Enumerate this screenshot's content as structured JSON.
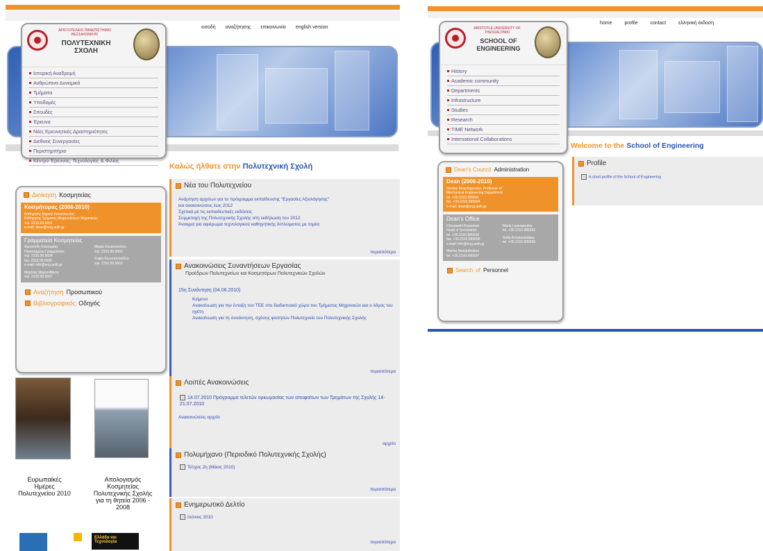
{
  "left": {
    "topnav": [
      "εισοδή",
      "αναζήτησης",
      "επικοινωνία",
      "english version"
    ],
    "university": "ΑΡΙΣΤΟΤΕΛΕΙΟ ΠΑΝΕΠΙΣΤΗΜΙΟ ΘΕΣΣΑΛΟΝΙΚΗΣ",
    "school": "ΠΟΛΥΤΕΧΝΙΚΗ ΣΧΟΛΗ",
    "menu": [
      "Ιστορική Αναδρομή",
      "Ανθρώπινο Δυναμικό",
      "Τμήματα",
      "Υποδομές",
      "Σπουδές",
      "Έρευνα",
      "Νέες Ερευνητικές Δραστηριότητες",
      "Διεθνείς Συνεργασίες",
      "Περιστηριτήριο",
      "Κέντρο Έρευνας, Τεχνολογίας & Φιλίας"
    ],
    "admin_title_a": "Διοίκηση",
    "admin_title_b": "Κοσμητείας",
    "dean_head": "Κοσμήτορας (2006-2010)",
    "dean_lines": [
      "Καθηγητής Μιχαήλ Κοντοπουλος",
      "Καθηγητής Τμήματος Μηχανολόγων Μηχανικών",
      "τηλ. 2310.99.5691",
      "e-mail: dean@eng.auth.gr"
    ],
    "office_head": "Γραμματεία Κοσμητείας",
    "office_col1": [
      "Χρυσάνθη Κασσιμάτη",
      "Προϊσταμένη Γραμματείας",
      "τηλ. 2310.99.5694",
      "fax: 2310.99.5695",
      "e-mail: info@eng.auth.gr",
      "",
      "Μαρίνας Μαριανθάκου",
      "τηλ. 2310.99.5697"
    ],
    "office_col2": [
      "Μαρία Λουκοπούλου",
      "τηλ. 2310.99.5692",
      "",
      "Σοφία Κωνσταντινίδου",
      "τηλ. 2310.99.5693"
    ],
    "search_a": "Αναζήτηση",
    "search_b": "Προσωπικού",
    "biblio_a": "Βιβλιογραφικός",
    "biblio_b": "Οδηγός",
    "welcome_a": "Καλώς ήλθατε στην",
    "welcome_b": "Πολυτεχνική Σχολή",
    "news_title": "Νέα του Πολυτεχνείου",
    "news_items": [
      "Ανάρτηση αρχείων για το πρόγραμμα εκπαίδευσης \"Εργασίες Αξιολόγησης\"",
      "και ανακοινώσεις έως 2012",
      "Σχετικά με τις εκπαιδευτικές εκδόσεις",
      "Συμμετοχή της Πολυτεχνικής Σχολής στη εκδήλωση του 2012",
      "Άνοιγμα για αφιέρωμα τεχνολογικού καθηγητικής διπλώματος με τομέα"
    ],
    "more": "περισσότερα",
    "meet_title": "Ανακοινώσεις Συναντήσεων Εργασίας",
    "meet_sub": "Προέδρων Πολυτεχνείων και Κοσμητόρων Πολυτεχνικών Σχολών",
    "meet_date": "15η Συνάντηση (04.06.2010)",
    "meet_items": [
      "Κείμενο",
      "Ανακοίνωση για την ένταξη του ΤΕΕ στο διαδικτυακό χώρο του Τμήματος Μηχανικών και ο λόγος του ηγέτη",
      "Ανακοίνωση για τη συνάντηση, σχέσης φοιτητών Πολυτεχνείο του Πολυτεχνικής Σχολής"
    ],
    "other_title": "Λοιπές Ανακοινώσεις",
    "other_item": "14.07.2010 Πρόγραμμα τελετών ορκωμοσίας των αποφοίτων των Τμημάτων της Σχολής 14-21.07.2010",
    "archive_link": "Ανακοινώσεις αρχείο",
    "archive": "αρχείο",
    "magazine_title": "Πολυμήχανο (Περιοδικό Πολυτεχνικής Σχολής)",
    "magazine_item": "Τεύχος 2η (Μάιος 2010)",
    "bulletin_title": "Ενημερωτικό Δελτίο",
    "bulletin_item": "Ιούνιος 2010",
    "caption1": "Ευρωπαϊκές Ημέρες Πολυτεχνείου 2010",
    "caption2": "Απολογισμός Κοσμητείας Πολυτεχνικής Σχολής για τη θητεία 2006 - 2008",
    "logo_text": "Ελλάδα και Τεχνολογία"
  },
  "right": {
    "topnav": [
      "home",
      "profile",
      "contact",
      "ελληνική έκδοση"
    ],
    "university": "ARISTOTLE UNIVERSITY OF THESSALONIKI",
    "school": "SCHOOL OF ENGINEERING",
    "menu": [
      "History",
      "Academic community",
      "Departments",
      "Infrastructure",
      "Studies",
      "Research",
      "TIME Network",
      "International Collaborations"
    ],
    "council_a": "Dean's Council",
    "council_b": "Administration",
    "dean_head": "Dean (2006-2010)",
    "dean_lines": [
      "Nicolas Moschopoulos, Professor of",
      "Mechanical Engineering Department",
      "tel. +30.2310.995691",
      "fax. +30.2310.995694",
      "e-mail: dean@eng.auth.gr"
    ],
    "office_head": "Dean's Office",
    "office_col1": [
      "Chrysanthi Kassimati",
      "Head of Secretariat",
      "tel. +30.2310.995694",
      "fax. +30.2310.995695",
      "e-mail: info@eng.auth.gr",
      "",
      "Marina Marianthakou",
      "tel. +30.2310.995697"
    ],
    "office_col2": [
      "Maria Loukopoulou",
      "tel. +30.2310.995692",
      "",
      "Sofia Konstantinidou",
      "tel. +30.2310.995693"
    ],
    "search_a": "Search",
    "search_b": "of",
    "search_c": "Personnel",
    "welcome_a": "Welcome to the",
    "welcome_b": "School of Engineering",
    "profile_title": "Profile",
    "profile_item": "A short profile of the School of Engineering"
  }
}
